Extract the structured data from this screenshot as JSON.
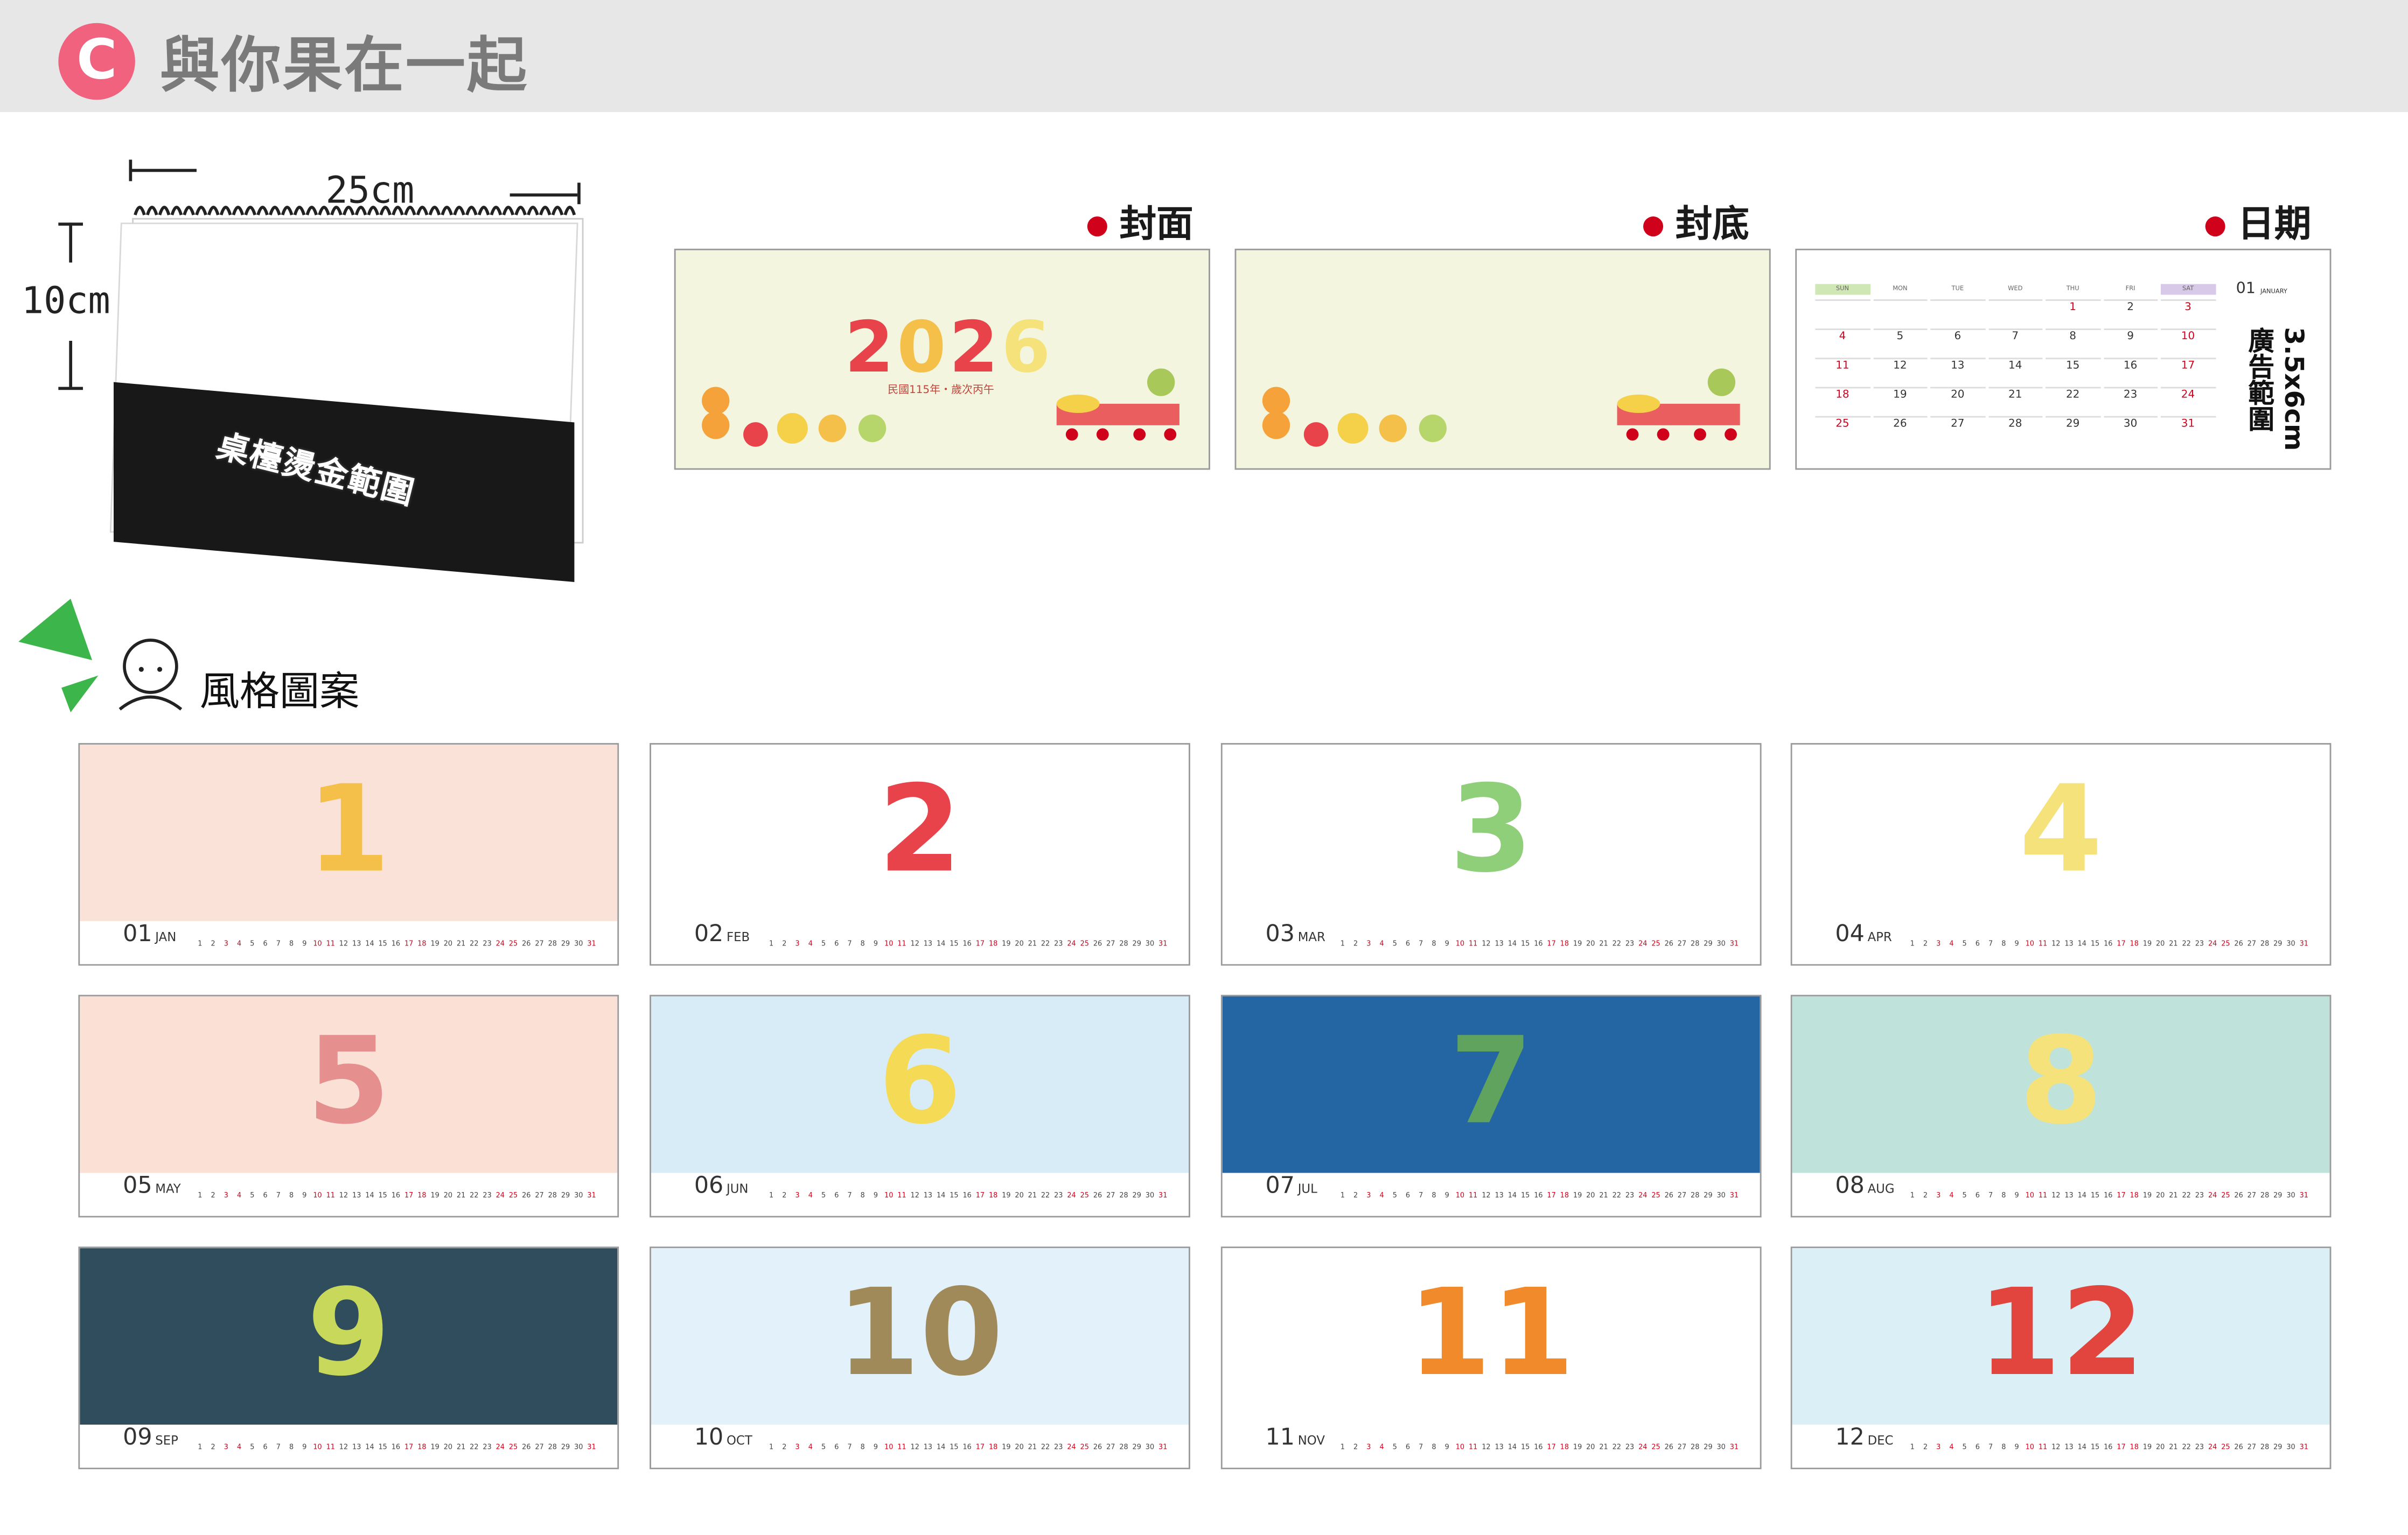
{
  "header": {
    "badge": "C",
    "title": "與你果在一起"
  },
  "illustration": {
    "width_label": "25cm",
    "height_label": "10cm",
    "base_label": "桌檯燙金範圍"
  },
  "samples": {
    "front_label": "封面",
    "back_label": "封底",
    "date_label": "日期",
    "cover_year": "2026",
    "cover_subtitle": "民國115年・歲次丙午",
    "ad_area": "3.5x6cm 廣告範圍",
    "date_preview": {
      "weekdays": [
        "SUN",
        "MON",
        "TUE",
        "WED",
        "THU",
        "FRI",
        "SAT"
      ],
      "month_num": "01",
      "month_name": "JANUARY",
      "rows": [
        [
          "",
          "",
          "",
          "",
          "1",
          "2",
          "3"
        ],
        [
          "4",
          "5",
          "6",
          "7",
          "8",
          "9",
          "10"
        ],
        [
          "11",
          "12",
          "13",
          "14",
          "15",
          "16",
          "17"
        ],
        [
          "18",
          "19",
          "20",
          "21",
          "22",
          "23",
          "24"
        ],
        [
          "25",
          "26",
          "27",
          "28",
          "29",
          "30",
          "31"
        ]
      ]
    }
  },
  "style_section": {
    "label": "風格圖案"
  },
  "months": [
    {
      "num": "01",
      "abbr": "JAN",
      "color": "#fbe2d8",
      "digit": "1",
      "digit_color": "#f5c04a"
    },
    {
      "num": "02",
      "abbr": "FEB",
      "color": "#ffffff",
      "digit": "2",
      "digit_color": "#e8434a"
    },
    {
      "num": "03",
      "abbr": "MAR",
      "color": "#ffffff",
      "digit": "3",
      "digit_color": "#8fcf7a"
    },
    {
      "num": "04",
      "abbr": "APR",
      "color": "#ffffff",
      "digit": "4",
      "digit_color": "#f5e27a"
    },
    {
      "num": "05",
      "abbr": "MAY",
      "color": "#fbe0d6",
      "digit": "5",
      "digit_color": "#e58f8f"
    },
    {
      "num": "06",
      "abbr": "JUN",
      "color": "#d8ecf7",
      "digit": "6",
      "digit_color": "#f5da55"
    },
    {
      "num": "07",
      "abbr": "JUL",
      "color": "#2366a3",
      "digit": "7",
      "digit_color": "#5fa35f"
    },
    {
      "num": "08",
      "abbr": "AUG",
      "color": "#bfe3da",
      "digit": "8",
      "digit_color": "#f5e27a"
    },
    {
      "num": "09",
      "abbr": "SEP",
      "color": "#2f4d5c",
      "digit": "9",
      "digit_color": "#c7d85a"
    },
    {
      "num": "10",
      "abbr": "OCT",
      "color": "#e3f1fa",
      "digit": "10",
      "digit_color": "#a08a5a"
    },
    {
      "num": "11",
      "abbr": "NOV",
      "color": "#ffffff",
      "digit": "11",
      "digit_color": "#f08a2a"
    },
    {
      "num": "12",
      "abbr": "DEC",
      "color": "#dbeff7",
      "digit": "12",
      "digit_color": "#e2453d"
    }
  ]
}
